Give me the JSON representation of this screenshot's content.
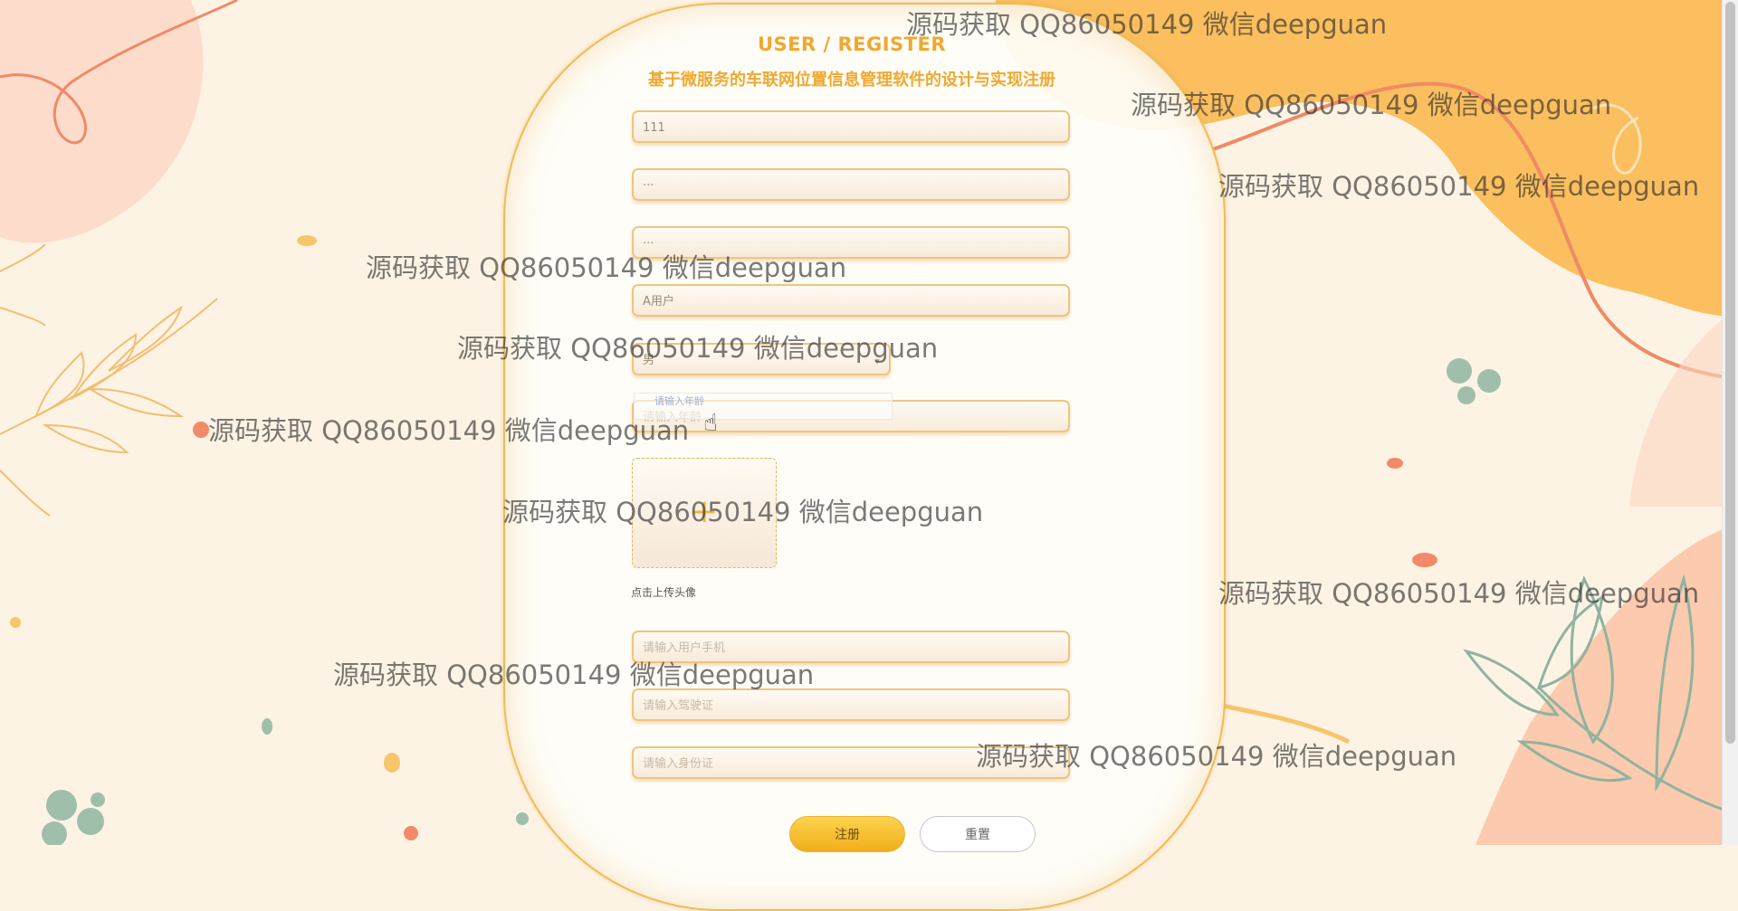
{
  "header": {
    "title_en": "USER / REGISTER",
    "title_cn": "基于微服务的车联网位置信息管理软件的设计与实现注册"
  },
  "form": {
    "account": {
      "value": "111"
    },
    "password": {
      "value": "···"
    },
    "confirm_password": {
      "value": "···"
    },
    "username": {
      "value": "A用户"
    },
    "gender": {
      "value": "男",
      "options": [
        "男"
      ]
    },
    "age": {
      "placeholder": "请输入年龄"
    },
    "avatar": {
      "label": "点击上传头像"
    },
    "phone": {
      "placeholder": "请输入用户手机"
    },
    "license": {
      "placeholder": "请输入驾驶证"
    },
    "id_card": {
      "placeholder": "请输入身份证"
    }
  },
  "dropdown_hint": {
    "text": "请输入年龄"
  },
  "buttons": {
    "submit": "注册",
    "reset": "重置"
  },
  "watermark": "源码获取 QQ86050149 微信deepguan",
  "colors": {
    "accent": "#f0a830",
    "background": "#fdf3e4",
    "orange_shape": "#fbbf5f",
    "leaf": "#9fbfab"
  }
}
